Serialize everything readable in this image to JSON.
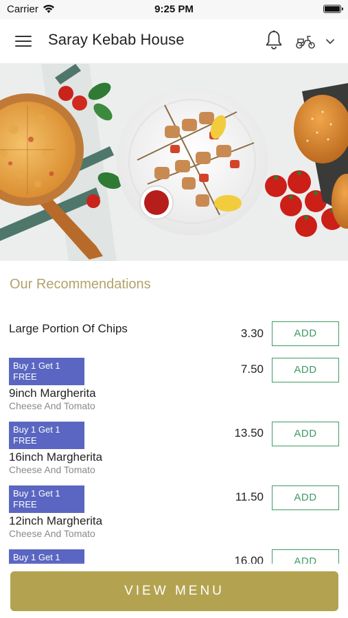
{
  "status_bar": {
    "carrier": "Carrier",
    "time": "9:25 PM"
  },
  "header": {
    "title": "Saray Kebab House",
    "icons": [
      "hamburger-menu-icon",
      "bell-icon",
      "scooter-icon",
      "chevron-down-icon"
    ]
  },
  "hero": {
    "image": "food-banner-pizza-kebab-burger"
  },
  "recommendations": {
    "title": "Our Recommendations",
    "add_label": "ADD",
    "items": [
      {
        "badge": "",
        "name": "Large Portion Of Chips",
        "description": "",
        "price": "3.30"
      },
      {
        "badge": "Buy 1 Get 1 FREE",
        "name": "9inch Margherita",
        "description": "Cheese And Tomato",
        "price": "7.50"
      },
      {
        "badge": "Buy 1 Get 1 FREE",
        "name": "16inch Margherita",
        "description": "Cheese And Tomato",
        "price": "13.50"
      },
      {
        "badge": "Buy 1 Get 1 FREE",
        "name": "12inch Margherita",
        "description": "Cheese And Tomato",
        "price": "11.50"
      },
      {
        "badge": "Buy 1 Get 1",
        "name": "",
        "description": "",
        "price": "16.00"
      }
    ]
  },
  "footer": {
    "view_menu_label": "VIEW MENU"
  },
  "colors": {
    "accent_gold": "#b3a350",
    "section_title": "#b3a26a",
    "badge_blue": "#5a66c1",
    "add_green": "#3d9a63"
  }
}
